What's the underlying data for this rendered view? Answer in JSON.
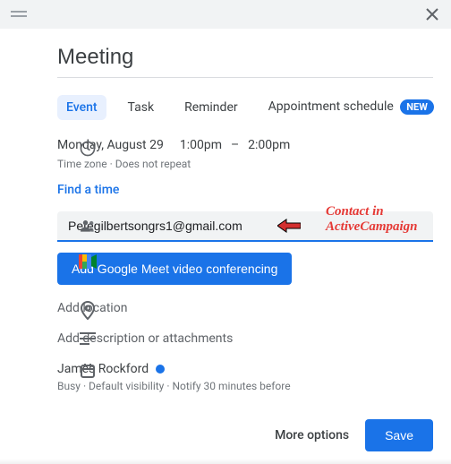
{
  "header": {
    "title_value": "Meeting"
  },
  "tabs": {
    "event": "Event",
    "task": "Task",
    "reminder": "Reminder",
    "appointment": "Appointment schedule",
    "new_badge": "NEW"
  },
  "datetime": {
    "date": "Monday, August 29",
    "start": "1:00pm",
    "dash": "–",
    "end": "2:00pm",
    "sub": "Time zone · Does not repeat",
    "find": "Find a time"
  },
  "guests": {
    "value": "Petegilbertsongrs1@gmail.com"
  },
  "annotation": {
    "line1": "Contact in",
    "line2": "ActiveCampaign"
  },
  "meet": {
    "button": "Add Google Meet video conferencing"
  },
  "location": {
    "placeholder": "Add location"
  },
  "description": {
    "placeholder": "Add description or attachments"
  },
  "organizer": {
    "name": "James Rockford",
    "sub": "Busy · Default visibility · Notify 30 minutes before"
  },
  "footer": {
    "more": "More options",
    "save": "Save"
  }
}
